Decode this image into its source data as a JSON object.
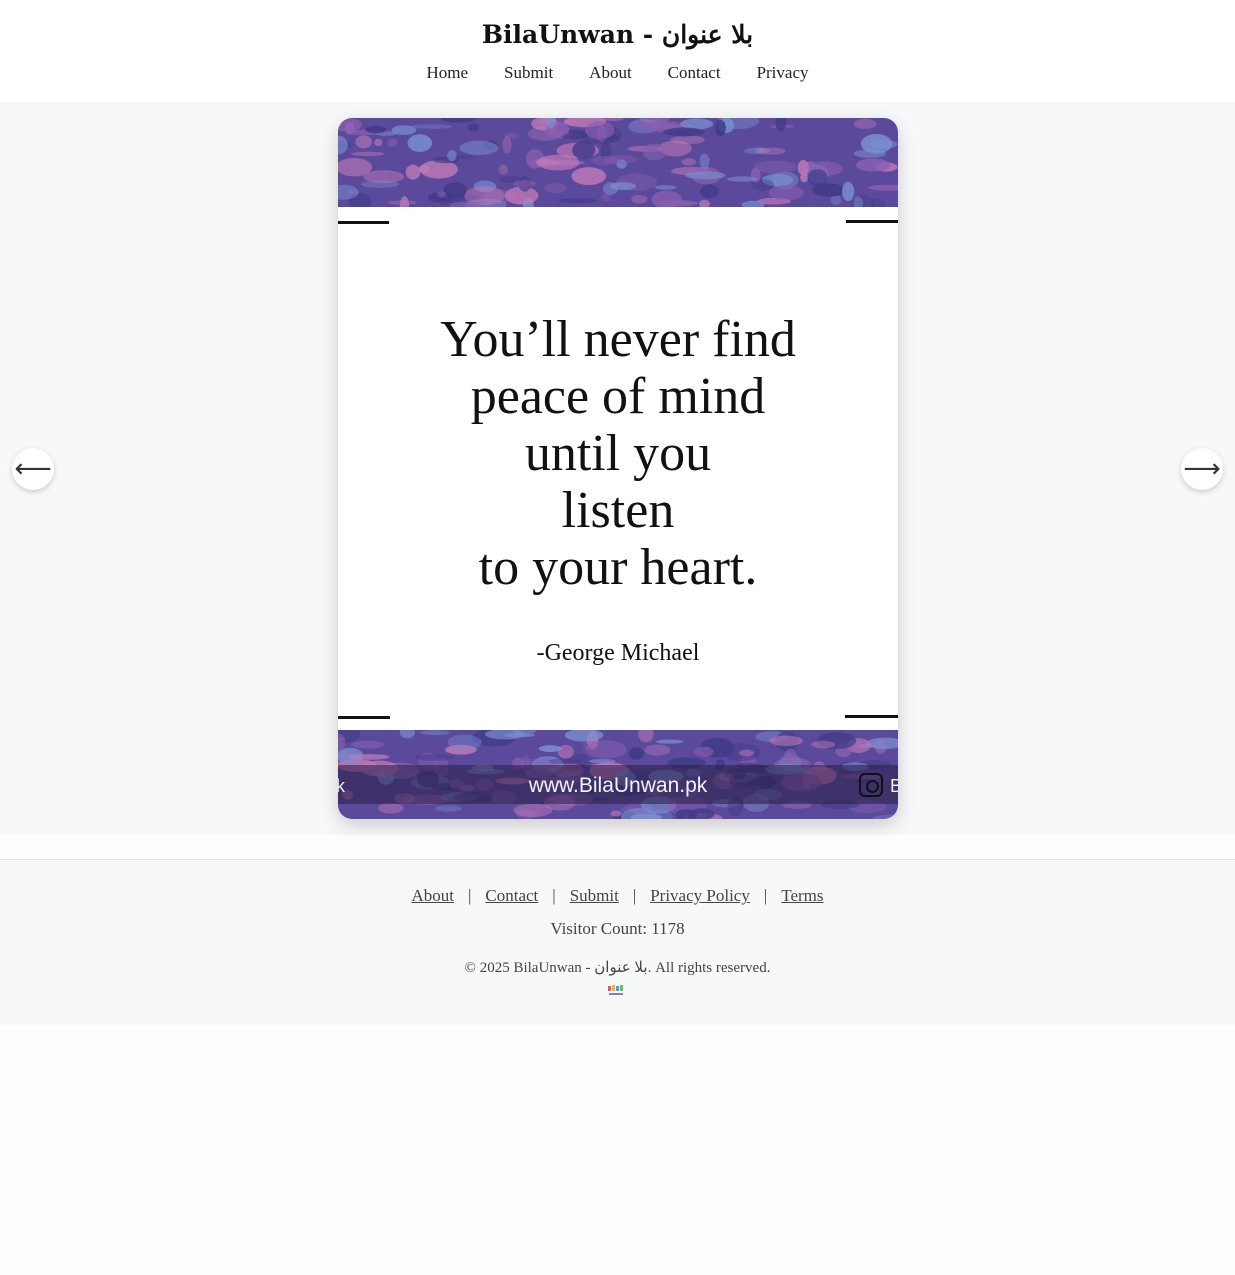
{
  "header": {
    "site_title": "BilaUnwan - بلا عنوان",
    "nav": [
      "Home",
      "Submit",
      "About",
      "Contact",
      "Privacy"
    ]
  },
  "slide": {
    "quote_lines": [
      "You’ll never find",
      "peace of mind",
      "until you",
      "listen",
      "to your heart."
    ],
    "author": "-George Michael",
    "website": "www.BilaUnwan.pk",
    "left_fragment": "k",
    "right_fragment": "B",
    "band_colors": [
      "#5b4a9c",
      "#8a5fb0",
      "#c27ab8",
      "#3f3a86",
      "#7a8fd0"
    ]
  },
  "carousel": {
    "prev_icon": "arrow-left-icon",
    "prev_glyph": "⟵",
    "next_icon": "arrow-right-icon",
    "next_glyph": "⟶"
  },
  "footer": {
    "links": [
      "About",
      "Contact",
      "Submit",
      "Privacy Policy",
      "Terms"
    ],
    "separator": "|",
    "visitor_count": "Visitor Count: 1178",
    "copyright": "© 2025 BilaUnwan - بلا عنوان. All rights reserved."
  }
}
